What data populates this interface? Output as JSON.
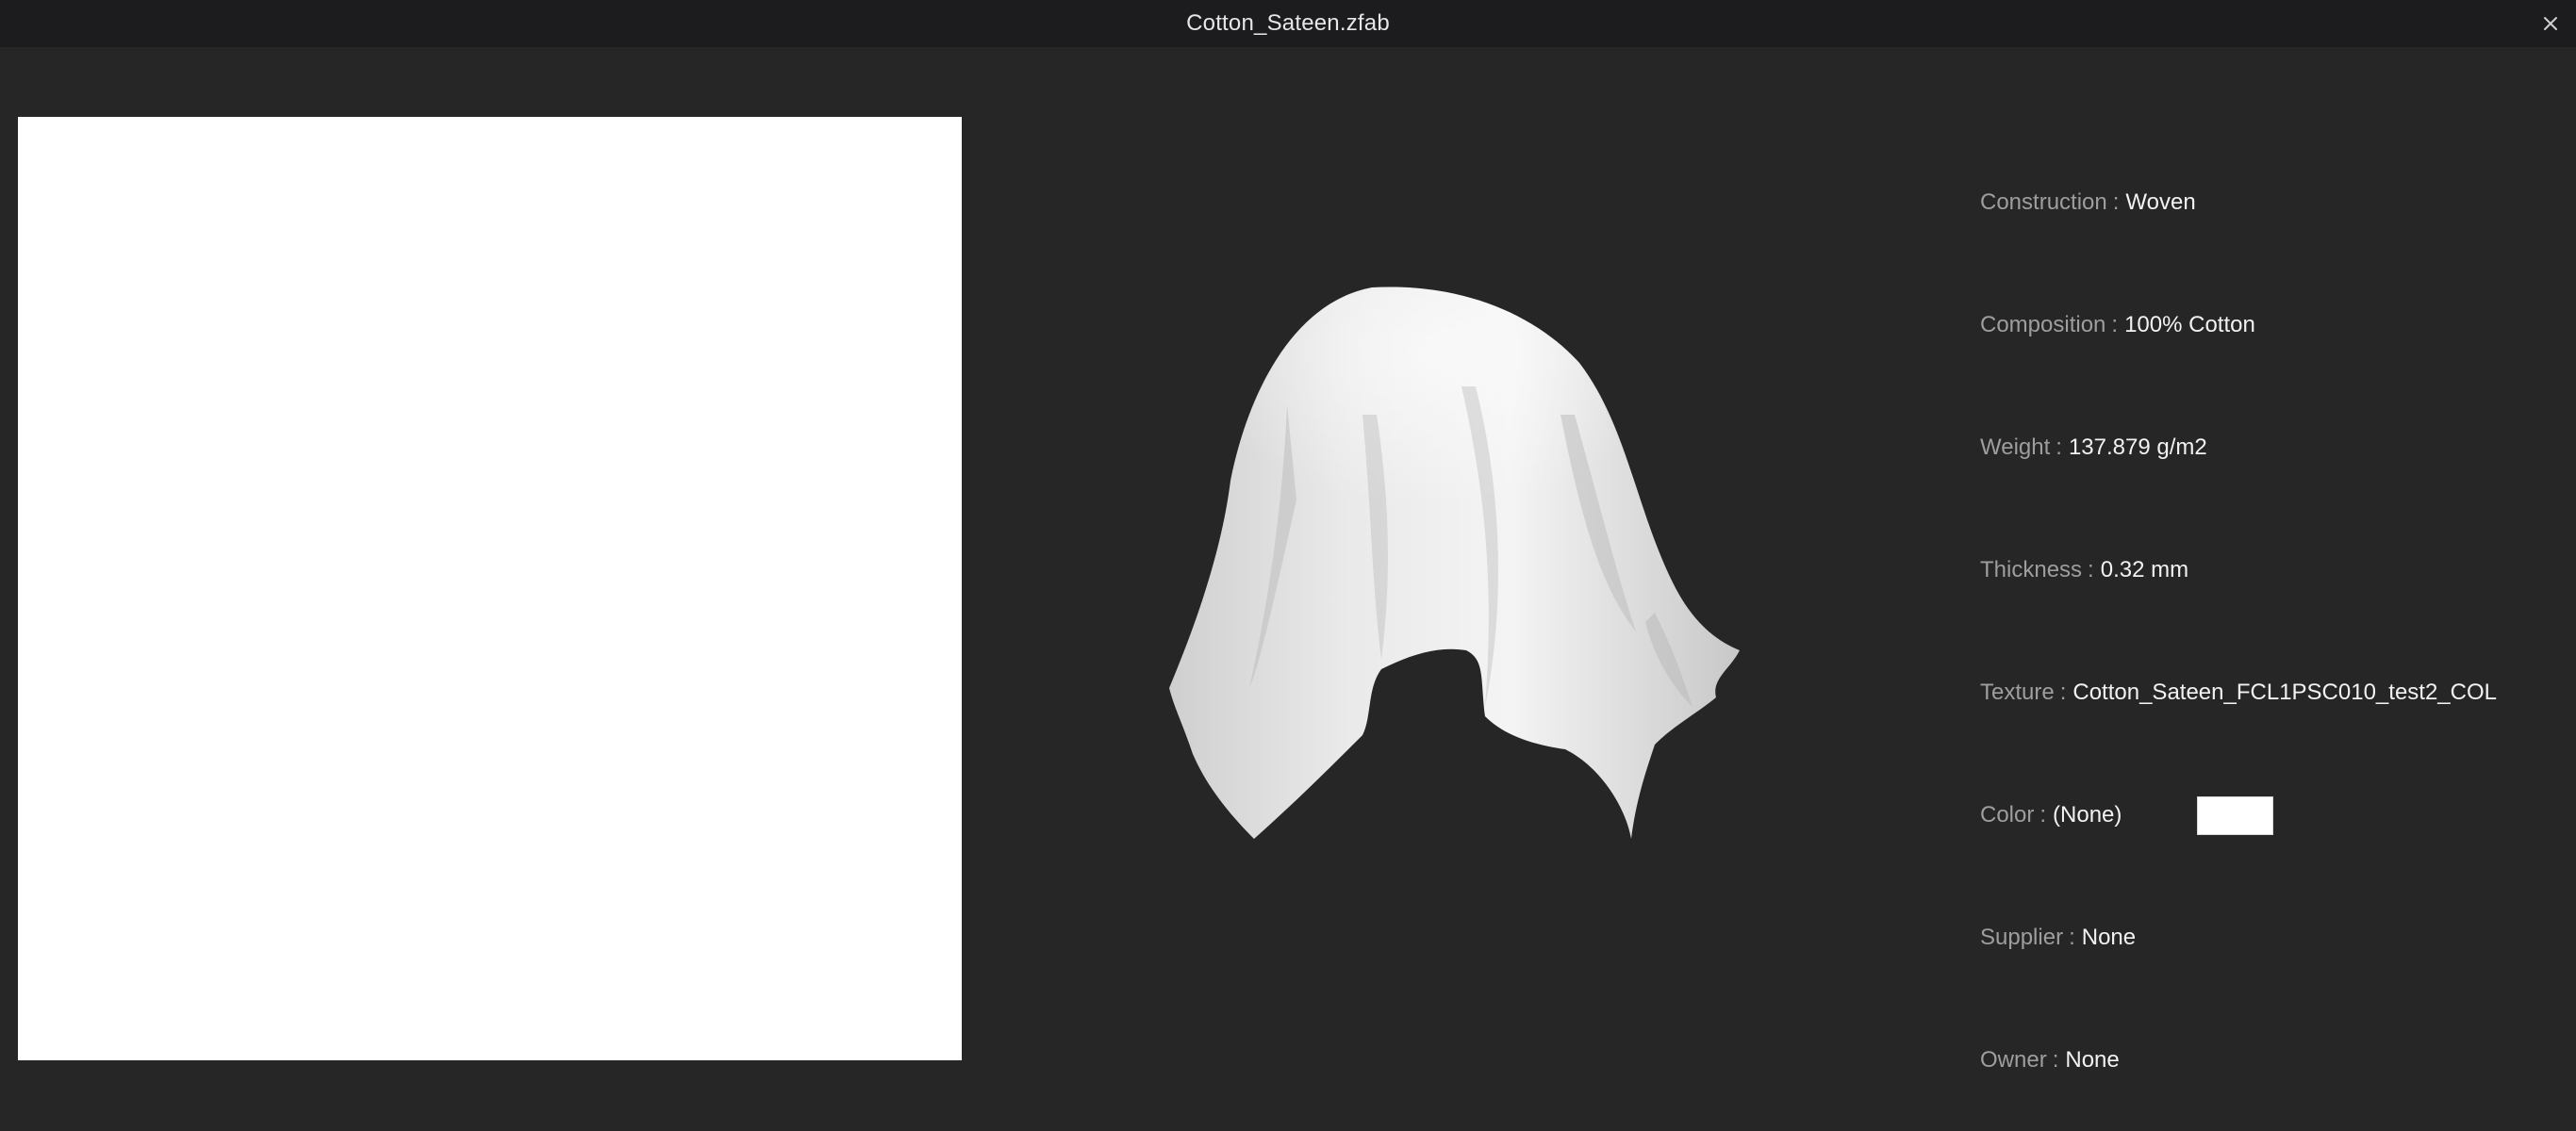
{
  "window": {
    "title": "Cotton_Sateen.zfab",
    "close_icon": "close-icon"
  },
  "texture_preview": {
    "color": "#FFFFFF"
  },
  "properties": [
    {
      "label": "Construction",
      "sep": ":",
      "value": "Woven"
    },
    {
      "label": "Composition",
      "sep": ":",
      "value": "100% Cotton"
    },
    {
      "label": "Weight",
      "sep": ":",
      "value": "137.879 g/m2"
    },
    {
      "label": "Thickness",
      "sep": ":",
      "value": "0.32 mm"
    },
    {
      "label": "Texture",
      "sep": ":",
      "value": "Cotton_Sateen_FCL1PSC010_test2_COL"
    },
    {
      "label": "Color",
      "sep": ":",
      "value": "(None)",
      "swatch_color": "#FFFFFF"
    },
    {
      "label": "Supplier",
      "sep": ":",
      "value": "None"
    },
    {
      "label": "Owner",
      "sep": ":",
      "value": "None"
    }
  ],
  "theme": {
    "background": "#262626",
    "titlebar": "#1C1C1E",
    "label_color": "#9E9E9E",
    "value_color": "#F2F2F2"
  }
}
